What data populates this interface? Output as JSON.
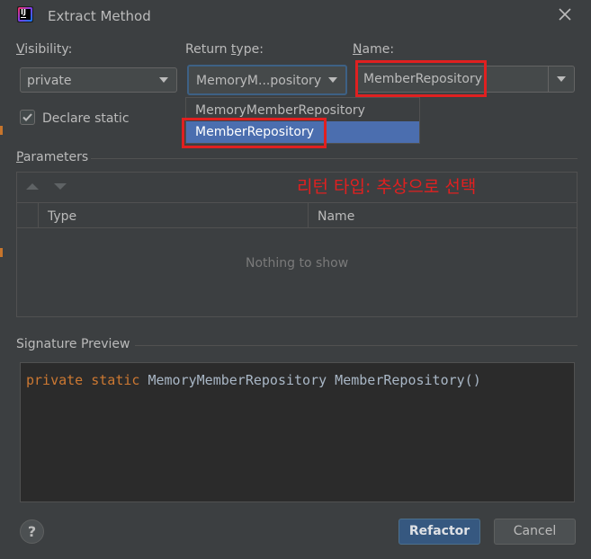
{
  "dialog": {
    "title": "Extract Method",
    "close_icon": "close-icon",
    "app_icon": "intellij-logo-icon",
    "app_icon_text": "IJ"
  },
  "visibility": {
    "label_u": "V",
    "label_rest": "isibility:",
    "value": "private"
  },
  "return_type": {
    "label_pre": "Return ",
    "label_u": "t",
    "label_post": "ype:",
    "value": "MemoryM...pository",
    "options": [
      "MemoryMemberRepository",
      "MemberRepository"
    ],
    "highlighted_index": 1
  },
  "name": {
    "label_u": "N",
    "label_rest": "ame:",
    "value": "MemberRepository"
  },
  "declare_static": {
    "label": "Declare static",
    "checked": true
  },
  "parameters": {
    "section_label_u": "P",
    "section_label_rest": "arameters",
    "columns": [
      "Type",
      "Name"
    ],
    "empty_text": "Nothing to show"
  },
  "annotation": {
    "text": "리턴 타입: 추상으로 선택",
    "color": "#e02020"
  },
  "signature": {
    "section_label": "Signature Preview",
    "kw_private": "private",
    "kw_static": "static",
    "rest": "MemoryMemberRepository MemberRepository()"
  },
  "footer": {
    "help": "?",
    "refactor": "Refactor",
    "cancel": "Cancel"
  },
  "colors": {
    "bg": "#3c3f41",
    "accent": "#365880",
    "selection": "#4b6eaf",
    "keyword": "#cc7832"
  }
}
